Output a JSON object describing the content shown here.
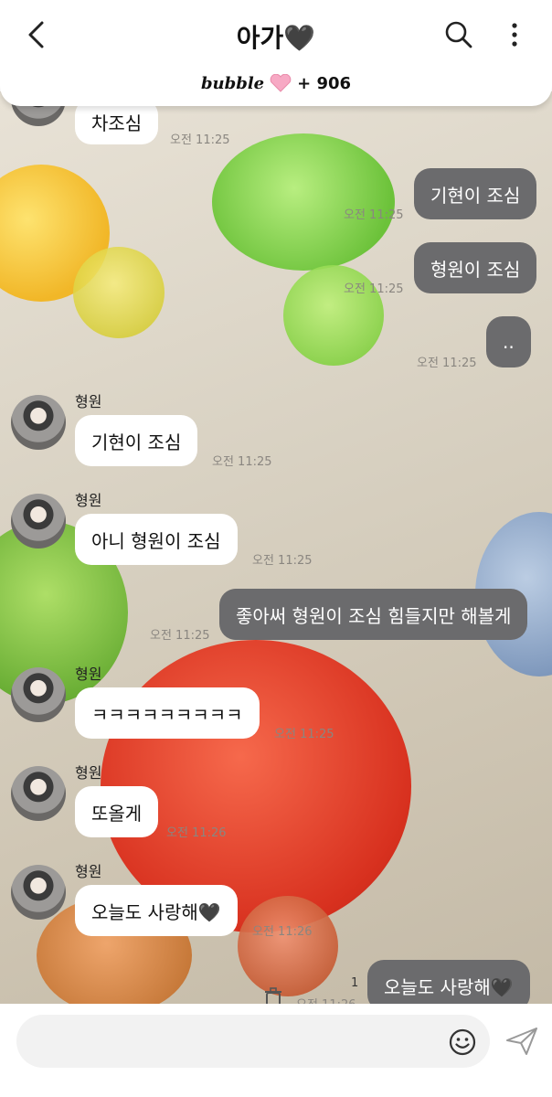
{
  "header": {
    "title": "아가🖤"
  },
  "banner": {
    "brand": "bubble",
    "count": "+ 906"
  },
  "messages": [
    {
      "text": "차조심",
      "time": "오전 11:25"
    },
    {
      "text": "기현이 조심",
      "read": "",
      "time": "오전 11:25"
    },
    {
      "text": "형원이 조심",
      "time": "오전 11:25"
    },
    {
      "text": "..",
      "time": "오전 11:25"
    },
    {
      "sender": "형원",
      "text": "기현이 조심",
      "time": "오전 11:25"
    },
    {
      "sender": "형원",
      "text": "아니 형원이 조심",
      "time": "오전 11:25"
    },
    {
      "text": "좋아써 형원이 조심 힘들지만 해볼게",
      "time": "오전 11:25"
    },
    {
      "sender": "형원",
      "text": "ㅋㅋㅋㅋㅋㅋㅋㅋㅋ",
      "time": "오전 11:25"
    },
    {
      "sender": "형원",
      "text": "또올게",
      "time": "오전 11:26"
    },
    {
      "sender": "형원",
      "text": "오늘도 사랑해🖤",
      "time": "오전 11:26"
    },
    {
      "text": "오늘도 사랑해🖤",
      "read": "1",
      "time": "오전 11:26"
    }
  ],
  "input": {
    "placeholder": ""
  },
  "colors": {
    "outgoing_bubble": "#6b6b6d",
    "incoming_bubble": "#ffffff"
  }
}
